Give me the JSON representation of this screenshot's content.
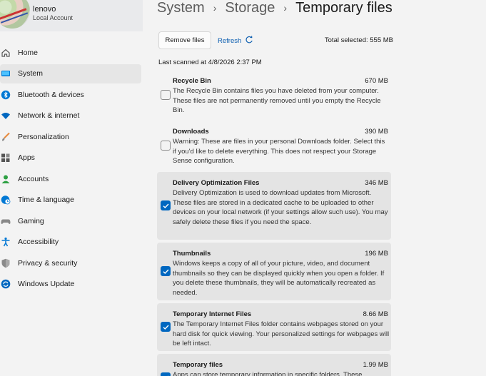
{
  "profile": {
    "name": "lenovo",
    "account_type": "Local Account"
  },
  "sidebar": {
    "items": [
      {
        "label": "Home",
        "icon": "home-icon",
        "color": "#555555"
      },
      {
        "label": "System",
        "icon": "system-icon",
        "color": "#0078d4",
        "active": true
      },
      {
        "label": "Bluetooth & devices",
        "icon": "bluetooth-icon",
        "color": "#0078d4"
      },
      {
        "label": "Network & internet",
        "icon": "network-icon",
        "color": "#0067c0"
      },
      {
        "label": "Personalization",
        "icon": "brush-icon",
        "color": "#e88a3c"
      },
      {
        "label": "Apps",
        "icon": "apps-icon",
        "color": "#555555"
      },
      {
        "label": "Accounts",
        "icon": "accounts-icon",
        "color": "#2ea043"
      },
      {
        "label": "Time & language",
        "icon": "globe-clock-icon",
        "color": "#0078d4"
      },
      {
        "label": "Gaming",
        "icon": "gamepad-icon",
        "color": "#888888"
      },
      {
        "label": "Accessibility",
        "icon": "accessibility-icon",
        "color": "#0078d4"
      },
      {
        "label": "Privacy & security",
        "icon": "shield-icon",
        "color": "#888888"
      },
      {
        "label": "Windows Update",
        "icon": "update-icon",
        "color": "#0067c0"
      }
    ]
  },
  "breadcrumb": {
    "items": [
      "System",
      "Storage",
      "Temporary files"
    ],
    "separator": "›"
  },
  "toolbar": {
    "remove_label": "Remove files",
    "refresh_label": "Refresh",
    "total_selected": "Total selected: 555 MB"
  },
  "last_scanned": "Last scanned at 4/8/2026 2:37 PM",
  "files": [
    {
      "title": "Recycle Bin",
      "size": "670 MB",
      "checked": false,
      "description": "The Recycle Bin contains files you have deleted from your computer. These files are not permanently removed until you empty the Recycle Bin."
    },
    {
      "title": "Downloads",
      "size": "390 MB",
      "checked": false,
      "description": "Warning: These are files in your personal Downloads folder. Select this if you'd like to delete everything. This does not respect your Storage Sense configuration."
    },
    {
      "title": "Delivery Optimization Files",
      "size": "346 MB",
      "checked": true,
      "description": "Delivery Optimization is used to download updates from Microsoft. These files are stored in a dedicated cache to be uploaded to other devices on your local network (if your settings allow such use). You may safely delete these files if you need the space."
    },
    {
      "title": "Thumbnails",
      "size": "196 MB",
      "checked": true,
      "description": "Windows keeps a copy of all of your picture, video, and document thumbnails so they can be displayed quickly when you open a folder. If you delete these thumbnails, they will be automatically recreated as needed."
    },
    {
      "title": "Temporary Internet Files",
      "size": "8.66 MB",
      "checked": true,
      "description": "The Temporary Internet Files folder contains webpages stored on your hard disk for quick viewing. Your personalized settings for webpages will be left intact."
    },
    {
      "title": "Temporary files",
      "size": "1.99 MB",
      "checked": true,
      "description": "Apps can store temporary information in specific folders. These"
    }
  ],
  "colors": {
    "accent": "#0067c0",
    "link": "#0a5db0",
    "checked_row": "#e4e4e4"
  }
}
